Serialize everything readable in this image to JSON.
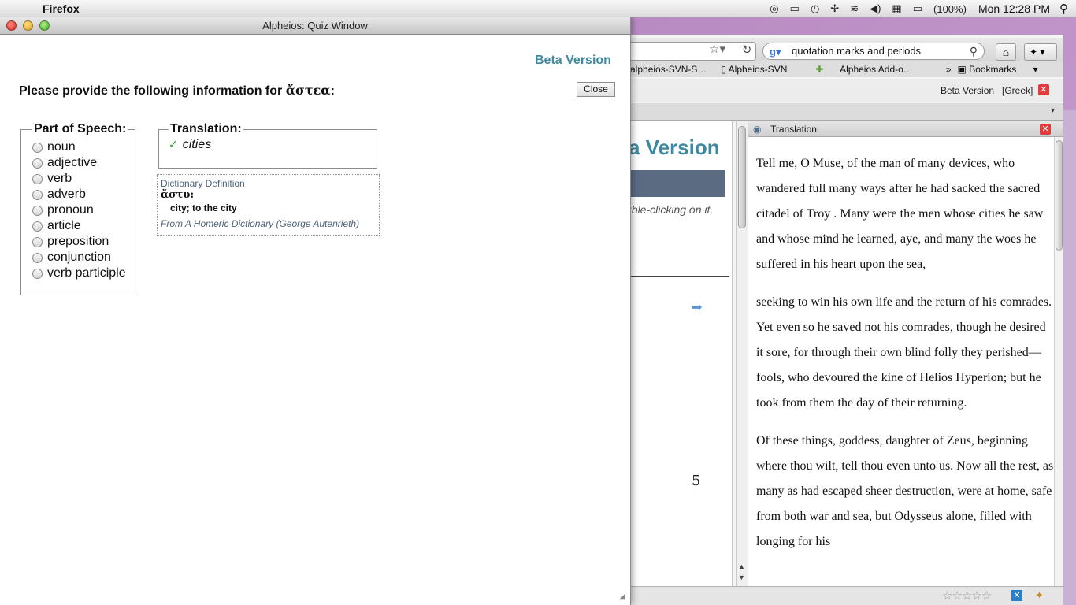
{
  "menubar": {
    "app": "Firefox",
    "battery": "(100%)",
    "clock": "Mon 12:28 PM"
  },
  "quiz": {
    "window_title": "Alpheios: Quiz Window",
    "beta_label": "Beta Version",
    "prompt_text": "Please provide the following information for ",
    "prompt_word": "ἄστεα",
    "prompt_suffix": ":",
    "close_label": "Close",
    "pos_legend": "Part of Speech:",
    "pos_options": [
      "noun",
      "adjective",
      "verb",
      "adverb",
      "pronoun",
      "article",
      "preposition",
      "conjunction",
      "verb participle"
    ],
    "translation_legend": "Translation:",
    "translation_answer": "cities",
    "dictionary_heading": "Dictionary Definition",
    "dictionary_lemma": "ἄστυ:",
    "dictionary_definition": "city; to the city",
    "dictionary_source": "From A Homeric Dictionary (George Autenrieth)"
  },
  "firefox": {
    "search_query": "quotation marks and periods",
    "bookmarks": [
      "alpheios-SVN-S…",
      "Alpheios-SVN",
      "Alpheios Add-o…"
    ],
    "bookmarks_menu": "Bookmarks",
    "toolbar_beta": "Beta Version",
    "toolbar_lang": "[Greek]",
    "page_heading_fragment": "a Version",
    "page_hint_fragment": "uble-clicking on it.",
    "page_number": "5",
    "translation_panel_title": "Translation",
    "translation_paragraphs": [
      "Tell me, O Muse, of the man of many devices, who wandered full many ways after he had sacked the sacred citadel of Troy . Many were the men whose cities he saw and whose mind he learned, aye, and many the woes he suffered in his heart upon the sea,",
      "seeking to win his own life and the return of his comrades. Yet even so he saved not his comrades, though he desired it sore, for through their own blind folly they perished—fools, who devoured the kine of Helios Hyperion; but he took from them the day of their returning.",
      "Of these things, goddess, daughter of Zeus, beginning where thou wilt, tell thou even unto us. Now all the rest, as many as had escaped sheer destruction, were at home, safe from both war and sea, but Odysseus alone, filled with longing for his"
    ]
  },
  "colors": {
    "accent_teal": "#3d8aa0",
    "check_green": "#2c9a2c",
    "close_red": "#e23b3b"
  }
}
